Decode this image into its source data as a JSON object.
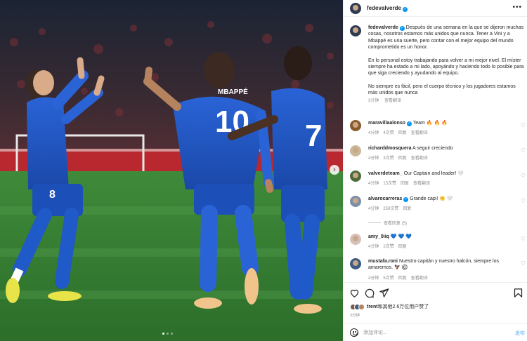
{
  "post": {
    "username": "fedevalverde",
    "more_icon": "more-horizontal-icon",
    "photo": {
      "jerseys": [
        "MBAPPÉ",
        "10",
        "7",
        "8"
      ],
      "next_icon": "chevron-right-icon",
      "carousel_count": 3,
      "carousel_active": 1
    },
    "caption": {
      "username": "fedevalverde",
      "p1": "Después de una semana en la que se dijeron muchas cosas, nosotros estamos más unidos que nunca. Tener a Vini y a Mbappé es una suerte, pero contar con el mejor equipo del mundo comprometido es un honor.",
      "p2": "En lo personal estoy trabajando para volver a mi mejor nivel. El míster siempre ha estado a mi lado, apoyándo y haciendo todo lo posible para que siga creciendo y ayudando al equipo.",
      "p3": "No siempre es fácil, pero el cuerpo técnico y los jugadores estamos más unidos que nunca",
      "time": "3分钟",
      "translate": "查看翻译"
    },
    "comments": [
      {
        "user": "maravillaalonso",
        "verified": true,
        "text": "Team 🔥 🔥 🔥",
        "time": "4分钟",
        "likes": "4次赞",
        "reply": "回复",
        "translate": "查看翻译"
      },
      {
        "user": "richarddmosquera",
        "verified": false,
        "text": "A seguir creciendo",
        "time": "4分钟",
        "likes": "3次赞",
        "reply": "回复",
        "translate": "查看翻译"
      },
      {
        "user": "valverdeteam_",
        "verified": false,
        "text": "Our Captain and leader! 🤍",
        "time": "4分钟",
        "likes": "15次赞",
        "reply": "回复",
        "translate": "查看翻译"
      },
      {
        "user": "alvarocarreras",
        "verified": true,
        "text": "Grande capi! 👏 🤍",
        "time": "4分钟",
        "likes": "259次赞",
        "reply": "回复",
        "translate": ""
      },
      {
        "user": "amy_0iiq",
        "verified": false,
        "text": "💙 💙 💙",
        "time": "4分钟",
        "likes": "2次赞",
        "reply": "回复",
        "translate": ""
      },
      {
        "user": "mustafa.roni",
        "verified": false,
        "text": "Nuestro capitán y nuestro halcón, siempre los amaremos. 🦅 ©️",
        "time": "4分钟",
        "likes": "5次赞",
        "reply": "回复",
        "translate": "查看翻译"
      }
    ],
    "view_replies": "查看回复 (5)",
    "likes": {
      "user": "trent",
      "rest": "和其他2.6万位用户赞了"
    },
    "date": "3分钟",
    "add_comment": {
      "placeholder": "添加评论...",
      "post_label": "发布"
    },
    "colors": {
      "accent": "#0095f6",
      "jersey": "#1f54c4",
      "muted": "#8e8e8e"
    },
    "icons": [
      "heart-icon",
      "comment-icon",
      "share-icon",
      "bookmark-icon",
      "emoji-icon",
      "verified-badge-icon"
    ]
  }
}
